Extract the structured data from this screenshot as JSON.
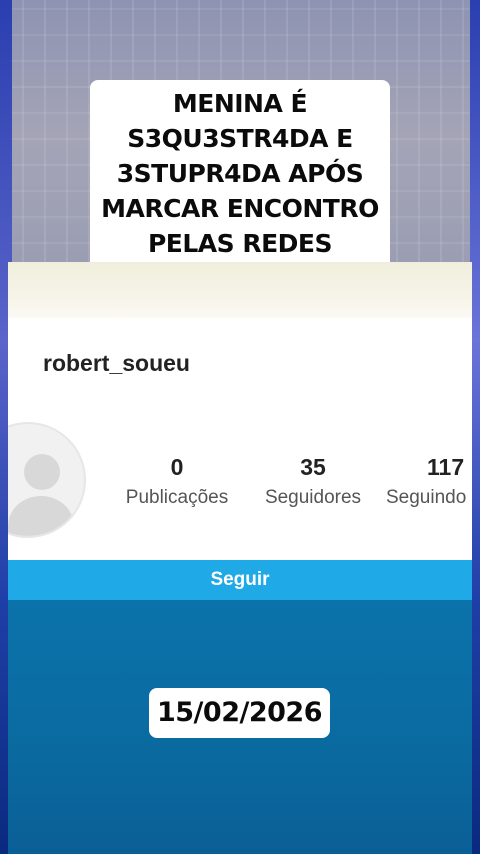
{
  "headline": {
    "lines": [
      "MENINA É",
      "S3QU3STR4DA E",
      "3STUPR4DA APÓS",
      "MARCAR ENCONTRO",
      "PELAS REDES SOCIAIS"
    ]
  },
  "profile": {
    "username": "robert_soueu",
    "stats": {
      "posts": {
        "value": "0",
        "label": "Publicações"
      },
      "followers": {
        "value": "35",
        "label": "Seguidores"
      },
      "following": {
        "value": "117",
        "label": "Seguindo"
      }
    },
    "follow_button": "Seguir"
  },
  "date": "15/02/2026",
  "colors": {
    "follow_button": "#1fa9e6",
    "lower_panel": "#0a6aa0"
  }
}
